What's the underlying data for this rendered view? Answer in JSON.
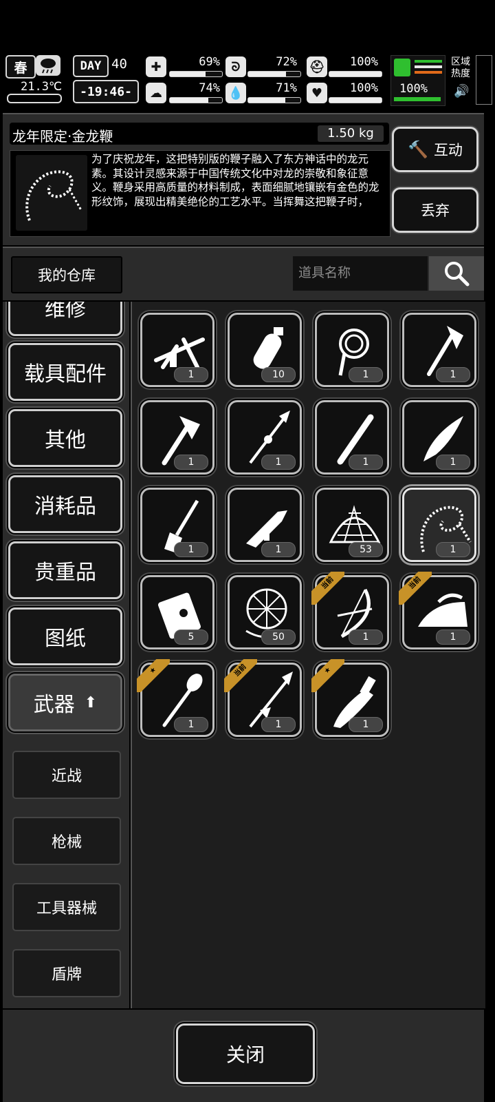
{
  "status": {
    "season": "春",
    "temperature": "21.3℃",
    "day_label": "DAY",
    "day_number": "40",
    "time": "-19:46-",
    "stats": [
      {
        "name": "health",
        "icon": "medkit-icon",
        "value": "69%",
        "level": 0.69
      },
      {
        "name": "hunger",
        "icon": "stomach-icon",
        "value": "72%",
        "level": 0.72
      },
      {
        "name": "armor",
        "icon": "helmet-icon",
        "value": "100%",
        "level": 1.0
      },
      {
        "name": "sanity",
        "icon": "brain-icon",
        "value": "74%",
        "level": 0.74
      },
      {
        "name": "thirst",
        "icon": "water-drop-icon",
        "value": "71%",
        "level": 0.71
      },
      {
        "name": "mood",
        "icon": "heart-icon",
        "value": "100%",
        "level": 1.0
      }
    ],
    "stamina_value": "100%",
    "stamina_level": 1.0,
    "zone_heat_label": "区域\n热度"
  },
  "item": {
    "name": "龙年限定·金龙鞭",
    "weight": "1.50 kg",
    "description": "为了庆祝龙年，这把特别版的鞭子融入了东方神话中的龙元素。其设计灵感来源于中国传统文化中对龙的崇敬和象征意义。鞭身采用高质量的材料制成，表面细腻地镶嵌有金色的龙形纹饰，展现出精美绝伦的工艺水平。当挥舞这把鞭子时，",
    "interact_label": "互动",
    "discard_label": "丢弃"
  },
  "storage": {
    "warehouse_label": "我的仓库",
    "search_placeholder": "道具名称"
  },
  "categories": [
    "维修",
    "载具配件",
    "其他",
    "消耗品",
    "贵重品",
    "图纸",
    "武器"
  ],
  "active_category": "武器",
  "subcategories": [
    "近战",
    "枪械",
    "工具器械",
    "盾牌"
  ],
  "items": [
    {
      "icon": "crossbow-icon",
      "qty": "1"
    },
    {
      "icon": "grenade-icon",
      "qty": "10"
    },
    {
      "icon": "rope-whip-icon",
      "qty": "1"
    },
    {
      "icon": "axe-icon",
      "qty": "1"
    },
    {
      "icon": "hatchet-icon",
      "qty": "1"
    },
    {
      "icon": "spear-icon",
      "qty": "1"
    },
    {
      "icon": "pipe-club-icon",
      "qty": "1"
    },
    {
      "icon": "knife-icon",
      "qty": "1"
    },
    {
      "icon": "shovel-blade-icon",
      "qty": "1"
    },
    {
      "icon": "rifle-icon",
      "qty": "1"
    },
    {
      "icon": "net-trap-icon",
      "qty": "53"
    },
    {
      "icon": "dragon-whip-icon",
      "qty": "1",
      "selected": true
    },
    {
      "icon": "explosive-pack-icon",
      "qty": "5"
    },
    {
      "icon": "fishing-net-icon",
      "qty": "50"
    },
    {
      "icon": "compound-bow-icon",
      "qty": "1",
      "badge": "当前"
    },
    {
      "icon": "flat-iron-icon",
      "qty": "1",
      "badge": "当前"
    },
    {
      "icon": "shovel-icon",
      "qty": "1",
      "badge": "★"
    },
    {
      "icon": "spearhead-icon",
      "qty": "1",
      "badge": "当前"
    },
    {
      "icon": "machete-icon",
      "qty": "1",
      "badge": "★"
    }
  ],
  "footer": {
    "close_label": "关闭"
  }
}
